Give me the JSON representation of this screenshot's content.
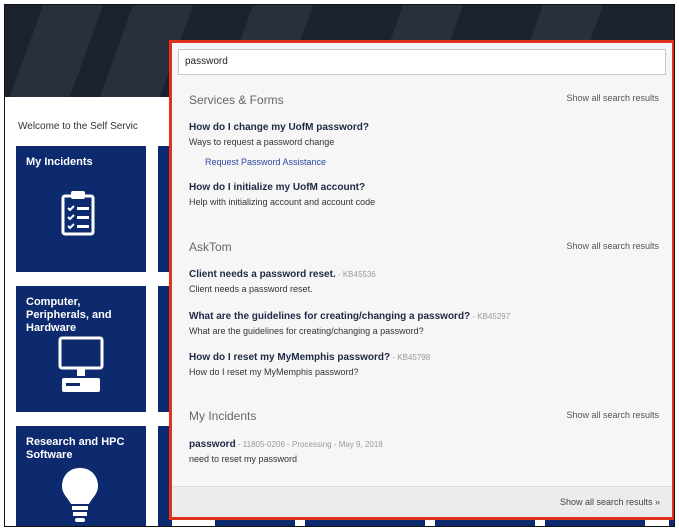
{
  "welcome_text": "Welcome to the Self Servic",
  "tiles": [
    {
      "label": "My Incidents",
      "icon": "clipboard-checklist-icon"
    },
    {
      "label": "Computer, Peripherals, and Hardware",
      "icon": "computer-monitor-icon"
    },
    {
      "label": "Research and HPC Software",
      "icon": "lightbulb-icon"
    }
  ],
  "search": {
    "value": "password"
  },
  "sections": [
    {
      "title": "Services & Forms",
      "show_all": "Show all search results",
      "items": [
        {
          "title": "How do I change my UofM password?",
          "subtitle": "Ways to request a password change",
          "link": "Request Password Assistance"
        },
        {
          "title": "How do I initialize my UofM account?",
          "subtitle": "Help with initializing account and account code"
        }
      ]
    },
    {
      "title": "AskTom",
      "show_all": "Show all search results",
      "items": [
        {
          "title": "Client needs a password reset.",
          "meta": " - KB45536",
          "subtitle": "Client needs a password reset."
        },
        {
          "title": "What are the guidelines for creating/changing a password?",
          "meta": " - KB45297",
          "subtitle": "What are the guidelines for creating/changing a password?"
        },
        {
          "title": "How do I reset my MyMemphis password?",
          "meta": " - KB45798",
          "subtitle": "How do I reset my MyMemphis password?"
        }
      ]
    },
    {
      "title": "My Incidents",
      "show_all": "Show all search results",
      "items": [
        {
          "title": "password",
          "meta": " - 11805-0206 - Processing - May 9, 2018",
          "subtitle": "need to reset my password"
        }
      ]
    }
  ],
  "footer_link": "Show all search results »",
  "colors": {
    "accent_border": "#e2321c",
    "tile_bg": "#0d2a6e",
    "header_bg": "#1c2230"
  }
}
